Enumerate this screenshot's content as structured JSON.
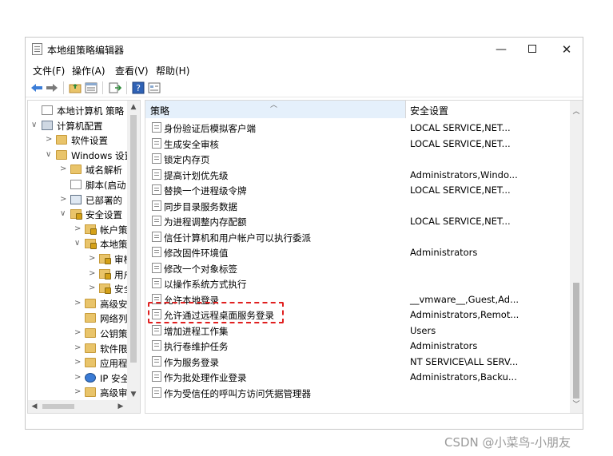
{
  "window": {
    "title": "本地组策略编辑器",
    "min_label": "—",
    "close_label": "✕"
  },
  "menu": [
    "文件(F)",
    "操作(A)",
    "查看(V)",
    "帮助(H)"
  ],
  "toolbar_icons": [
    "back-arrow-icon",
    "forward-arrow-icon",
    "folder-up-icon",
    "properties-icon",
    "export-icon",
    "help-icon",
    "view-icon"
  ],
  "tree": {
    "items": [
      {
        "label": "本地计算机 策略",
        "expander": "",
        "icon": "doc"
      },
      {
        "label": "计算机配置",
        "expander": "∨",
        "icon": "pc"
      },
      {
        "label": "软件设置",
        "expander": ">",
        "icon": "folder"
      },
      {
        "label": "Windows 设置",
        "expander": "∨",
        "icon": "folder"
      },
      {
        "label": "域名解析",
        "expander": ">",
        "icon": "folder"
      },
      {
        "label": "脚本(启动",
        "expander": "",
        "icon": "doc"
      },
      {
        "label": "已部署的",
        "expander": ">",
        "icon": "monitor"
      },
      {
        "label": "安全设置",
        "expander": "∨",
        "icon": "lock"
      },
      {
        "label": "帐户策",
        "expander": ">",
        "icon": "lock"
      },
      {
        "label": "本地策",
        "expander": "∨",
        "icon": "lock"
      },
      {
        "label": "审核",
        "expander": ">",
        "icon": "lock"
      },
      {
        "label": "用户",
        "expander": ">",
        "icon": "lock"
      },
      {
        "label": "安全",
        "expander": ">",
        "icon": "lock"
      },
      {
        "label": "高级安",
        "expander": ">",
        "icon": "folder"
      },
      {
        "label": "网络列",
        "expander": "",
        "icon": "folder"
      },
      {
        "label": "公钥策",
        "expander": ">",
        "icon": "folder"
      },
      {
        "label": "软件限",
        "expander": ">",
        "icon": "folder"
      },
      {
        "label": "应用程",
        "expander": ">",
        "icon": "folder"
      },
      {
        "label": "IP 安全",
        "expander": ">",
        "icon": "ip"
      },
      {
        "label": "高级审",
        "expander": ">",
        "icon": "folder"
      }
    ]
  },
  "list": {
    "columns": {
      "policy": "策略",
      "setting": "安全设置"
    },
    "rows": [
      {
        "name": "身份验证后模拟客户端",
        "value": "LOCAL SERVICE,NET..."
      },
      {
        "name": "生成安全审核",
        "value": "LOCAL SERVICE,NET..."
      },
      {
        "name": "锁定内存页",
        "value": ""
      },
      {
        "name": "提高计划优先级",
        "value": "Administrators,Windo..."
      },
      {
        "name": "替换一个进程级令牌",
        "value": "LOCAL SERVICE,NET..."
      },
      {
        "name": "同步目录服务数据",
        "value": ""
      },
      {
        "name": "为进程调整内存配额",
        "value": "LOCAL SERVICE,NET..."
      },
      {
        "name": "信任计算机和用户帐户可以执行委派",
        "value": ""
      },
      {
        "name": "修改固件环境值",
        "value": "Administrators"
      },
      {
        "name": "修改一个对象标签",
        "value": ""
      },
      {
        "name": "以操作系统方式执行",
        "value": ""
      },
      {
        "name": "允许本地登录",
        "value": "__vmware__,Guest,Ad..."
      },
      {
        "name": "允许通过远程桌面服务登录",
        "value": "Administrators,Remot..."
      },
      {
        "name": "增加进程工作集",
        "value": "Users"
      },
      {
        "name": "执行卷维护任务",
        "value": "Administrators"
      },
      {
        "name": "作为服务登录",
        "value": "NT SERVICE\\ALL SERV..."
      },
      {
        "name": "作为批处理作业登录",
        "value": "Administrators,Backu..."
      },
      {
        "name": "作为受信任的呼叫方访问凭据管理器",
        "value": ""
      }
    ]
  },
  "highlight_color": "#e02020",
  "watermark": "CSDN @小菜鸟-小朋友"
}
